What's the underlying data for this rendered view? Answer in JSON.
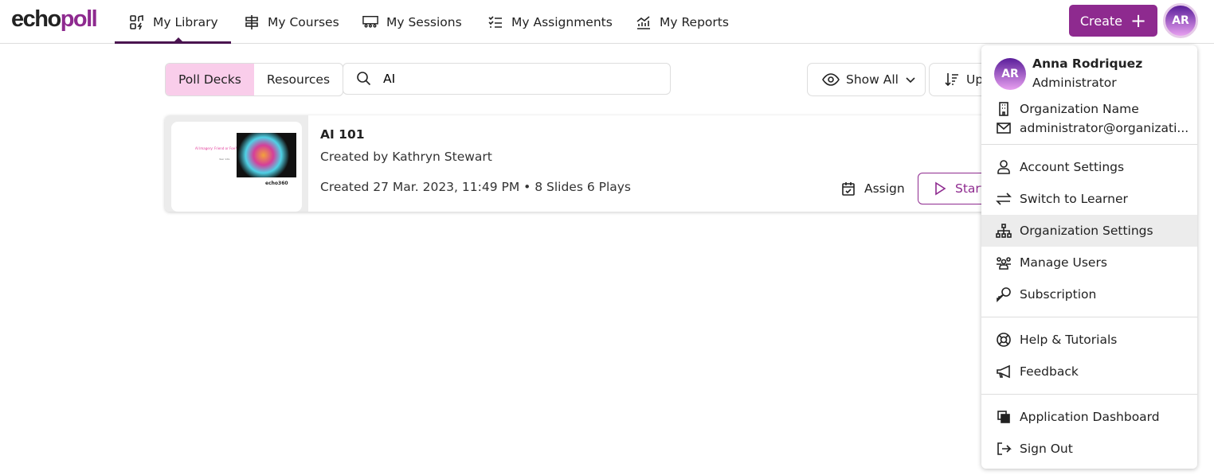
{
  "brand": {
    "part1": "echo",
    "part2": "poll"
  },
  "nav": [
    {
      "label": "My Library",
      "icon": "library-icon",
      "active": true
    },
    {
      "label": "My Courses",
      "icon": "signpost-icon"
    },
    {
      "label": "My Sessions",
      "icon": "sessions-icon"
    },
    {
      "label": "My Assignments",
      "icon": "checklist-icon"
    },
    {
      "label": "My Reports",
      "icon": "chart-icon"
    }
  ],
  "create_label": "Create",
  "user": {
    "initials": "AR",
    "name": "Anna Rodriquez",
    "role": "Administrator",
    "org": "Organization Name",
    "email": "administrator@organizati..."
  },
  "tabs": [
    {
      "label": "Poll Decks",
      "active": true
    },
    {
      "label": "Resources"
    }
  ],
  "search": {
    "value": "AI"
  },
  "filter_label": "Show All",
  "sort_label": "Up",
  "deck": {
    "title": "AI 101",
    "created_by": "Created by  Kathryn Stewart",
    "meta": "Created 27 Mar. 2023, 11:49 PM • 8 Slides 6 Plays",
    "thumb_title": "AI Imagery: Friend or Foe?",
    "thumb_sub": "Year 12G",
    "thumb_logo": "echo360",
    "assign": "Assign",
    "start": "Start"
  },
  "menu": {
    "items": [
      {
        "label": "Account Settings"
      },
      {
        "label": "Switch to Learner"
      },
      {
        "label": "Organization Settings"
      },
      {
        "label": "Manage Users"
      },
      {
        "label": "Subscription"
      },
      {
        "label": "Help & Tutorials"
      },
      {
        "label": "Feedback"
      },
      {
        "label": "Application Dashboard"
      },
      {
        "label": "Sign Out"
      }
    ]
  },
  "colors": {
    "brand": "#8e2a8f",
    "active_tab": "#f9cdea",
    "nav_underline": "#4a1450"
  }
}
